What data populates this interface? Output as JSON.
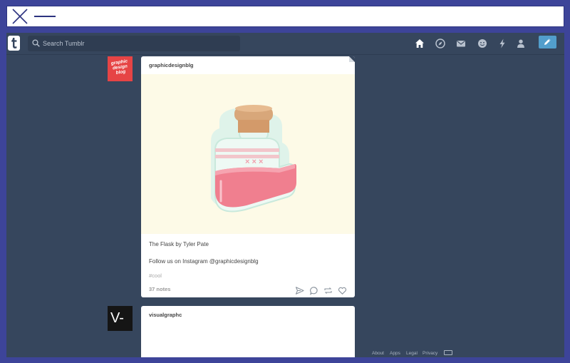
{
  "window": {
    "controls": [
      "close-icon",
      "minimize-icon"
    ]
  },
  "nav": {
    "search_placeholder": "Search Tumblr",
    "icons": [
      "tumblr-logo-icon",
      "home-icon",
      "explore-compass-icon",
      "inbox-mail-icon",
      "messaging-smiley-icon",
      "activity-lightning-icon",
      "account-person-icon",
      "compose-pencil-icon"
    ]
  },
  "posts": [
    {
      "blog": "graphicdesignblg",
      "avatar_text": "graphic design blog",
      "caption_title": "The Flask by Tyler Pate",
      "caption_body": "Follow us on Instagram @graphicdesignblg",
      "tag": "#cool",
      "notes": "37 notes",
      "actions": [
        "share-icon",
        "reply-icon",
        "reblog-icon",
        "like-heart-icon"
      ]
    },
    {
      "blog": "visualgraphc",
      "avatar_text": "V-"
    }
  ],
  "footer": {
    "links": [
      "About",
      "Apps",
      "Legal",
      "Privacy"
    ]
  },
  "colors": {
    "dashboard_bg": "#36465d",
    "outer_frame": "#3d4499",
    "compose_accent": "#529ecc",
    "image_bg": "#fdfae7",
    "flask_liquid": "#f07f8f"
  }
}
